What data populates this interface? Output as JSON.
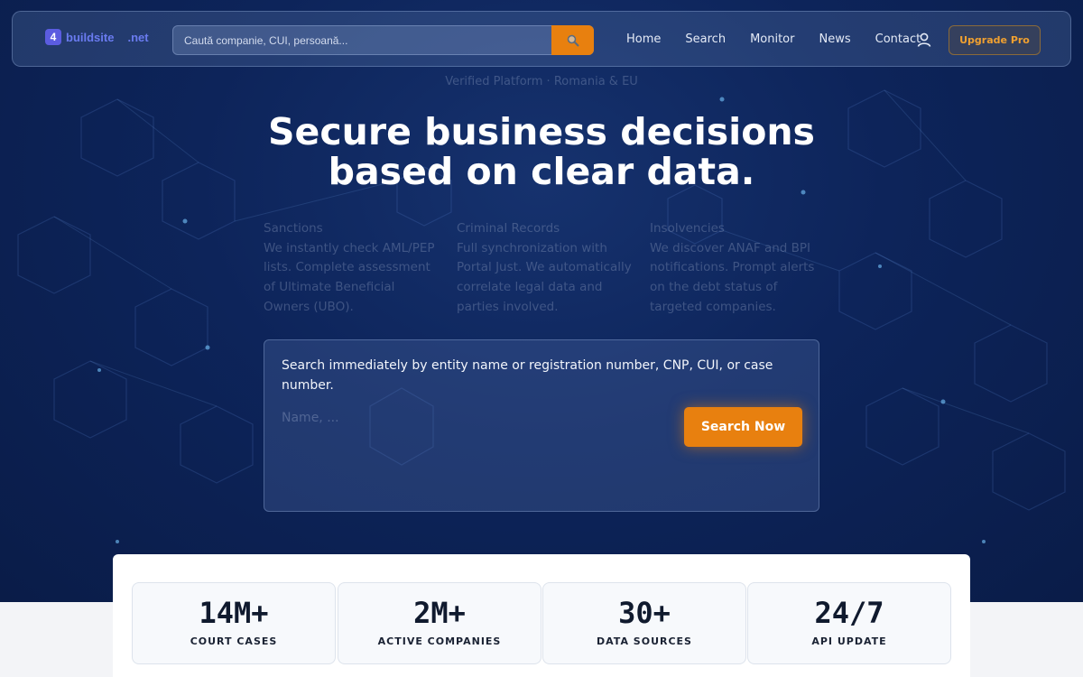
{
  "nav": {
    "logo_badge": "4",
    "logo_text": "buildsite",
    "logo_tld": ".net",
    "search_placeholder": "Caută companie, CUI, persoană...",
    "search_icon": "magnifier-icon",
    "links": [
      "Home",
      "Search",
      "Monitor",
      "News",
      "Contact"
    ],
    "user_icon": "user-icon",
    "upgrade_label": "Upgrade Pro"
  },
  "hero": {
    "verified": "Verified Platform · Romania & EU",
    "headline_line1": "Secure business decisions",
    "headline_line2": "based on clear data."
  },
  "features": [
    {
      "title": "Sanctions",
      "text": "We instantly check AML/PEP lists. Complete assessment of Ultimate Beneficial Owners (UBO)."
    },
    {
      "title": "Criminal Records",
      "text": "Full synchronization with Portal Just. We automatically correlate legal data and parties involved."
    },
    {
      "title": "Insolvencies",
      "text": "We discover ANAF and BPI notifications. Prompt alerts on the debt status of targeted companies."
    }
  ],
  "search_card": {
    "description": "Search immediately by entity name or registration number, CNP, CUI, or case number.",
    "input_placeholder": "Name, ...",
    "button_label": "Search Now"
  },
  "stats": [
    {
      "value": "14M+",
      "label": "COURT CASES"
    },
    {
      "value": "2M+",
      "label": "ACTIVE COMPANIES"
    },
    {
      "value": "30+",
      "label": "DATA SOURCES"
    },
    {
      "value": "24/7",
      "label": "API UPDATE"
    }
  ],
  "colors": {
    "accent": "#e8800f",
    "hero_bg": "#0d245a",
    "logo": "#5b5ce0"
  }
}
